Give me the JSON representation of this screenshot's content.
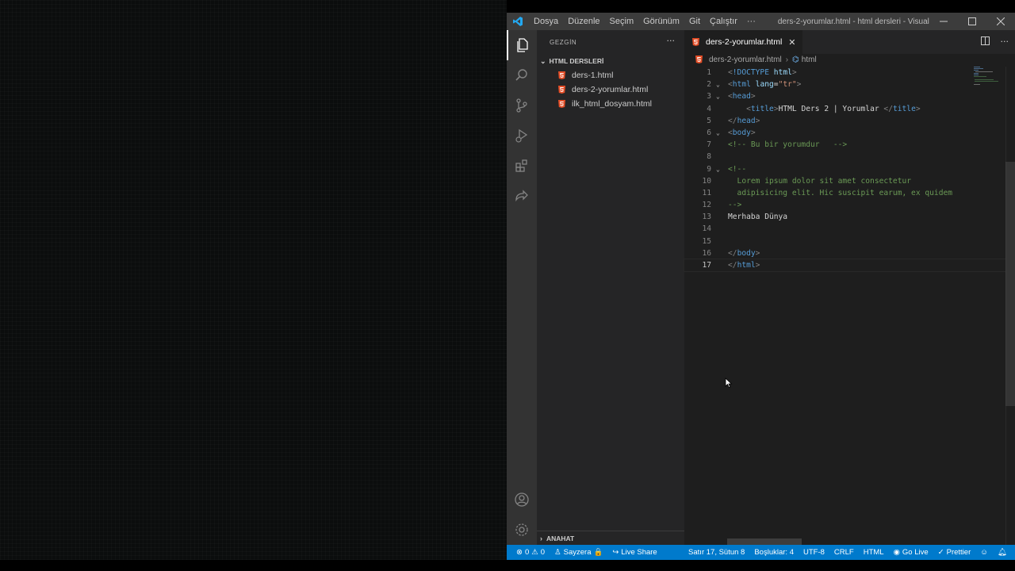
{
  "colors": {
    "accent": "#007acc",
    "html_icon": "#e44d26",
    "tag": "#569cd6",
    "attribute": "#9cdcfe",
    "string": "#ce9178",
    "comment": "#6a9955"
  },
  "titlebar": {
    "menu": [
      "Dosya",
      "Düzenle",
      "Seçim",
      "Görünüm",
      "Git",
      "Çalıştır",
      "···"
    ],
    "title": "ders-2-yorumlar.html - html dersleri - Visual...",
    "controls": [
      "minimize-icon",
      "maximize-icon",
      "close-icon"
    ]
  },
  "activity_bar": {
    "items": [
      "explorer-icon",
      "search-icon",
      "source-control-icon",
      "run-debug-icon",
      "extensions-icon",
      "live-share-icon"
    ],
    "bottom": [
      "account-icon",
      "settings-gear-icon"
    ]
  },
  "sidebar": {
    "header": "GEZGİN",
    "more": "···",
    "folder": "HTML DERSLERİ",
    "files": [
      "ders-1.html",
      "ders-2-yorumlar.html",
      "ilk_html_dosyam.html"
    ],
    "outline": "ANAHAT"
  },
  "editor": {
    "tab_label": "ders-2-yorumlar.html",
    "breadcrumb": [
      "ders-2-yorumlar.html",
      "html"
    ],
    "current_line": 17,
    "lines": [
      {
        "n": "1",
        "fold": "",
        "tokens": [
          [
            "punc",
            "<"
          ],
          [
            "tag",
            "!DOCTYPE"
          ],
          [
            "plain",
            " "
          ],
          [
            "attr",
            "html"
          ],
          [
            "punc",
            ">"
          ]
        ]
      },
      {
        "n": "2",
        "fold": "⌄",
        "tokens": [
          [
            "punc",
            "<"
          ],
          [
            "tag",
            "html"
          ],
          [
            "plain",
            " "
          ],
          [
            "attr",
            "lang"
          ],
          [
            "plain",
            "="
          ],
          [
            "str",
            "\"tr\""
          ],
          [
            "punc",
            ">"
          ]
        ]
      },
      {
        "n": "3",
        "fold": "⌄",
        "tokens": [
          [
            "punc",
            "<"
          ],
          [
            "tag",
            "head"
          ],
          [
            "punc",
            ">"
          ]
        ]
      },
      {
        "n": "4",
        "fold": "",
        "tokens": [
          [
            "plain",
            "    "
          ],
          [
            "punc",
            "<"
          ],
          [
            "tag",
            "title"
          ],
          [
            "punc",
            ">"
          ],
          [
            "plain",
            "HTML Ders 2 | Yorumlar "
          ],
          [
            "punc",
            "</"
          ],
          [
            "tag",
            "title"
          ],
          [
            "punc",
            ">"
          ]
        ]
      },
      {
        "n": "5",
        "fold": "",
        "tokens": [
          [
            "punc",
            "</"
          ],
          [
            "tag",
            "head"
          ],
          [
            "punc",
            ">"
          ]
        ]
      },
      {
        "n": "6",
        "fold": "⌄",
        "tokens": [
          [
            "punc",
            "<"
          ],
          [
            "tag",
            "body"
          ],
          [
            "punc",
            ">"
          ]
        ]
      },
      {
        "n": "7",
        "fold": "",
        "tokens": [
          [
            "com",
            "<!-- Bu bir yorumdur   -->"
          ]
        ]
      },
      {
        "n": "8",
        "fold": "",
        "tokens": []
      },
      {
        "n": "9",
        "fold": "⌄",
        "tokens": [
          [
            "com",
            "<!--"
          ]
        ]
      },
      {
        "n": "10",
        "fold": "",
        "tokens": [
          [
            "com",
            "  Lorem ipsum dolor sit amet consectetur"
          ]
        ]
      },
      {
        "n": "11",
        "fold": "",
        "tokens": [
          [
            "com",
            "  adipisicing elit. Hic suscipit earum, ex quidem"
          ]
        ]
      },
      {
        "n": "12",
        "fold": "",
        "tokens": [
          [
            "com",
            "-->"
          ]
        ]
      },
      {
        "n": "13",
        "fold": "",
        "tokens": [
          [
            "plain",
            "Merhaba Dünya"
          ]
        ]
      },
      {
        "n": "14",
        "fold": "",
        "tokens": []
      },
      {
        "n": "15",
        "fold": "",
        "tokens": []
      },
      {
        "n": "16",
        "fold": "",
        "tokens": [
          [
            "punc",
            "</"
          ],
          [
            "tag",
            "body"
          ],
          [
            "punc",
            ">"
          ]
        ]
      },
      {
        "n": "17",
        "fold": "",
        "tokens": [
          [
            "punc",
            "</"
          ],
          [
            "tag",
            "html"
          ],
          [
            "punc",
            ">"
          ]
        ]
      }
    ]
  },
  "statusbar": {
    "errors": "0",
    "warnings": "0",
    "user": "Sayzera",
    "live_share": "Live Share",
    "position": "Satır 17, Sütun 8",
    "spaces": "Boşluklar: 4",
    "encoding": "UTF-8",
    "eol": "CRLF",
    "language": "HTML",
    "go_live": "Go Live",
    "prettier": "Prettier"
  }
}
